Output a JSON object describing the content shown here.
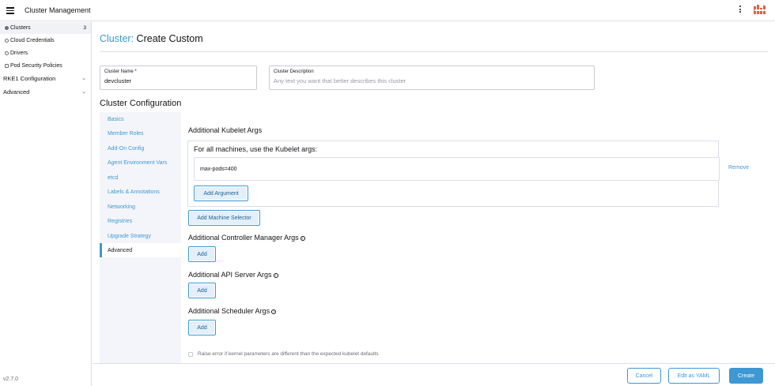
{
  "header": {
    "title": "Cluster Management",
    "menu_icon": "hamburger-menu-icon",
    "more_icon": "kebab-menu-icon",
    "logo_icon": "rancher-logo-icon",
    "logo_color": "#e35d4a"
  },
  "sidebar": {
    "items": [
      {
        "label": "Clusters",
        "badge": "3"
      },
      {
        "label": "Cloud Credentials"
      },
      {
        "label": "Drivers"
      },
      {
        "label": "Pod Security Policies"
      }
    ],
    "groups": [
      {
        "label": "RKE1 Configuration"
      },
      {
        "label": "Advanced"
      }
    ],
    "version": "v2.7.0"
  },
  "page": {
    "title_prefix": "Cluster:",
    "title_suffix": " Create Custom",
    "cluster_name": {
      "label": "Cluster Name *",
      "value": "devcluster"
    },
    "cluster_description": {
      "label": "Cluster Description",
      "placeholder": "Any text you want that better describes this cluster",
      "value": ""
    },
    "section_title": "Cluster Configuration"
  },
  "tabs": [
    {
      "label": "Basics"
    },
    {
      "label": "Member Roles"
    },
    {
      "label": "Add-On Config"
    },
    {
      "label": "Agent Environment Vars"
    },
    {
      "label": "etcd"
    },
    {
      "label": "Labels & Annotations"
    },
    {
      "label": "Networking"
    },
    {
      "label": "Registries"
    },
    {
      "label": "Upgrade Strategy"
    },
    {
      "label": "Advanced"
    }
  ],
  "panel": {
    "kubelet_title": "Additional Kubelet Args",
    "kubelet_box_title": "For all machines, use the Kubelet args:",
    "kubelet_arg_value": "max-pods=400",
    "remove_label": "Remove",
    "add_argument_label": "Add Argument",
    "add_machine_selector_label": "Add Machine Selector",
    "controller_title": "Additional Controller Manager Args",
    "api_title": "Additional API Server Args",
    "scheduler_title": "Additional Scheduler Args",
    "add_label": "Add",
    "info_glyph": "i",
    "kernel_check_label": "Raise error if kernel parameters are different than the expected kubelet defaults"
  },
  "footer": {
    "cancel_label": "Cancel",
    "yaml_label": "Edit as YAML",
    "create_label": "Create"
  }
}
